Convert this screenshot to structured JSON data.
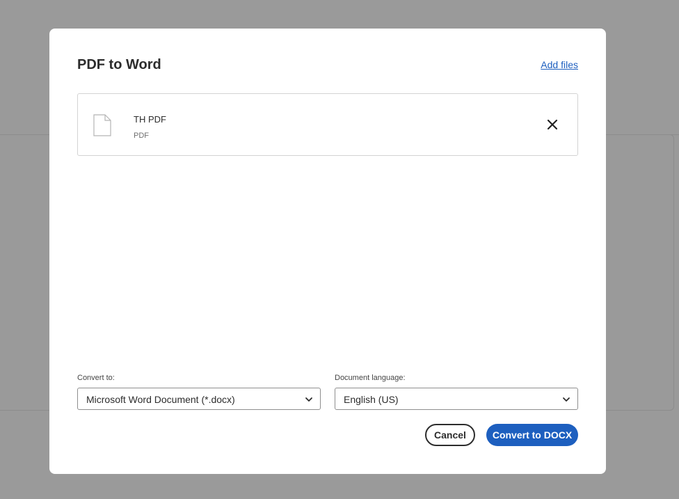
{
  "dialog": {
    "title": "PDF to Word",
    "add_files_label": "Add files"
  },
  "file": {
    "name": "TH PDF",
    "type": "PDF",
    "icon": "document-icon",
    "remove_icon": "close-icon"
  },
  "convert_to": {
    "label": "Convert to:",
    "selected": "Microsoft Word Document (*.docx)"
  },
  "document_language": {
    "label": "Document language:",
    "selected": "English (US)"
  },
  "actions": {
    "cancel_label": "Cancel",
    "convert_label": "Convert to DOCX"
  },
  "colors": {
    "accent": "#1d5fbf",
    "backdrop": "#9a9a9a"
  }
}
